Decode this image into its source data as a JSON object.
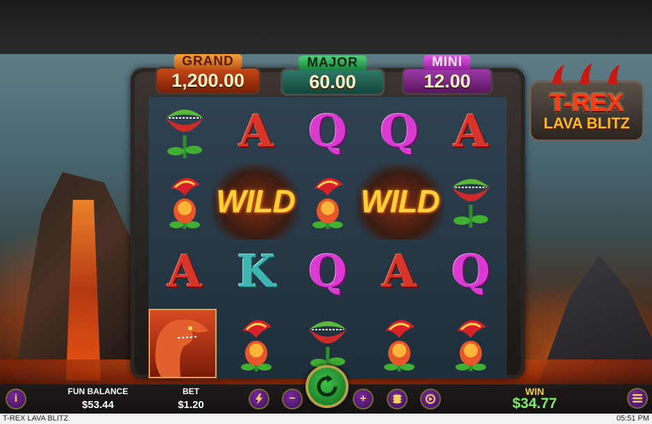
{
  "game": {
    "title": "T-REX LAVA BLITZ",
    "logo_line1": "T-REX",
    "logo_line2": "LAVA BLITZ"
  },
  "jackpots": {
    "grand": {
      "label": "GRAND",
      "value": "1,200.00"
    },
    "major": {
      "label": "MAJOR",
      "value": "60.00"
    },
    "mini": {
      "label": "MINI",
      "value": "12.00"
    }
  },
  "reels": [
    [
      "flytrap",
      "lava-flower",
      "A",
      "trex"
    ],
    [
      "A",
      "wild",
      "K",
      "lava-flower"
    ],
    [
      "Q",
      "lava-flower",
      "Q",
      "flytrap"
    ],
    [
      "Q",
      "wild",
      "A",
      "lava-flower"
    ],
    [
      "A",
      "flytrap",
      "Q",
      "lava-flower"
    ]
  ],
  "symbols": {
    "wild_text": "WILD",
    "letter_A": "A",
    "letter_Q": "Q",
    "letter_K": "K"
  },
  "hud": {
    "fun_balance_label": "FUN BALANCE",
    "fun_balance_value": "$53.44",
    "bet_label": "BET",
    "bet_value": "$1.20",
    "win_label": "WIN",
    "win_value": "$34.77",
    "info_glyph": "i",
    "minus_glyph": "−",
    "plus_glyph": "+"
  },
  "footer": {
    "title": "T-REX LAVA BLITZ",
    "time": "05:51 PM"
  },
  "colors": {
    "win_value": "#7cf06a",
    "win_label": "#f5d33a",
    "spin_button": "#2da23a"
  }
}
